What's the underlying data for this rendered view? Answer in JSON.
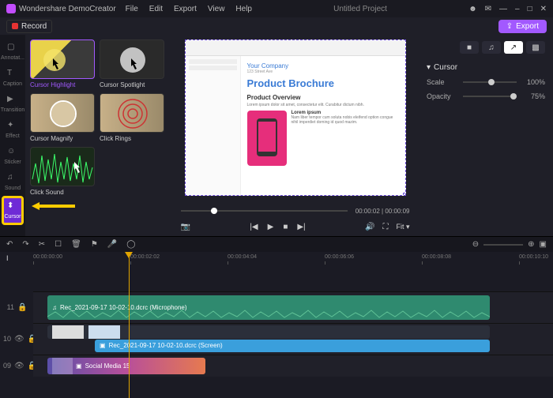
{
  "app": {
    "name": "Wondershare DemoCreator"
  },
  "menu": [
    "File",
    "Edit",
    "Export",
    "View",
    "Help"
  ],
  "project": {
    "title": "Untitled Project"
  },
  "toolbar": {
    "record": "Record",
    "export": "Export"
  },
  "rail": [
    {
      "id": "annotate",
      "label": "Annotat..."
    },
    {
      "id": "caption",
      "label": "Caption"
    },
    {
      "id": "transition",
      "label": "Transition"
    },
    {
      "id": "effect",
      "label": "Effect"
    },
    {
      "id": "sticker",
      "label": "Sticker"
    },
    {
      "id": "sound",
      "label": "Sound"
    },
    {
      "id": "cursor",
      "label": "Cursor"
    }
  ],
  "library": [
    {
      "label": "Cursor Highlight",
      "selected": true
    },
    {
      "label": "Cursor Spotlight",
      "selected": false
    },
    {
      "label": "Cursor Magnify",
      "selected": false
    },
    {
      "label": "Click Rings",
      "selected": false
    },
    {
      "label": "Click Sound",
      "selected": false
    }
  ],
  "preview": {
    "doc": {
      "company": "Your Company",
      "title": "Product Brochure",
      "section": "Product Overview",
      "para1": "Lorem ipsum dolor sit amet, consectetur elit. Curabitur dictum nibh.",
      "sub": "Lorem ipsum",
      "para2": "Nam liber tempor cum soluta nobis eleifend option congue nihil imperdiet doming id quod mazim."
    },
    "time_current": "00:00:02",
    "time_total": "00:00:09",
    "fit": "Fit"
  },
  "props": {
    "section": "Cursor",
    "scale": {
      "label": "Scale",
      "value": "100%",
      "pos": 32
    },
    "opacity": {
      "label": "Opacity",
      "value": "75%",
      "pos": 100
    }
  },
  "ruler": {
    "label": "I",
    "marks": [
      "00:00:00:00",
      "00:00:02:02",
      "00:00:04:04",
      "00:00:06:06",
      "00:00:08:08",
      "00:00:10:10"
    ]
  },
  "tracks": {
    "audio": {
      "num": "11",
      "clip": "Rec_2021-09-17 10-02-10.dcrc (Microphone)"
    },
    "video": {
      "num": "10",
      "clip": "Rec_2021-09-17 10-02-10.dcrc (Screen)"
    },
    "media": {
      "num": "09",
      "clip": "Social Media 15"
    }
  }
}
